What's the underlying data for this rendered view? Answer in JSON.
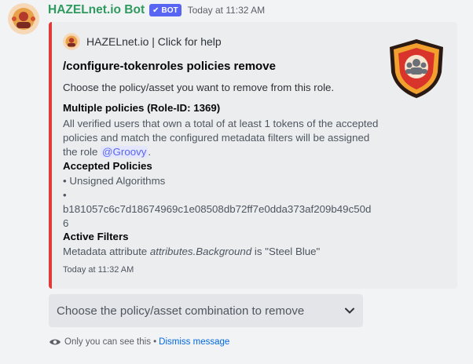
{
  "message": {
    "author": "HAZELnet.io Bot",
    "bot_tag": "BOT",
    "timestamp": "Today at 11:32 AM"
  },
  "embed": {
    "accent_color": "#e03a3a",
    "author_name": "HAZELnet.io | Click for help",
    "title": "/configure-tokenroles policies remove",
    "description": "Choose the policy/asset you want to remove from this role.",
    "fields": [
      {
        "name": "Multiple policies (Role-ID: 1369)",
        "value_lines": [
          "All verified users that own a total of at least 1 tokens of the accepted",
          "policies and match the configured metadata filters will be assigned"
        ],
        "value_tail": "the role ",
        "mention": "@Groovy",
        "value_end": "."
      },
      {
        "name": "Accepted Policies",
        "value_lines": [
          "• Unsigned Algorithms",
          "•",
          "b181057c6c7d18674969c1e08508db72ff7e0dda373af209b49c50d",
          "6"
        ]
      },
      {
        "name": "Active Filters",
        "value_prefix": "Metadata attribute ",
        "value_italic": "attributes.Background",
        "value_suffix": " is \"Steel Blue\""
      }
    ],
    "footer_timestamp": "Today at 11:32 AM"
  },
  "select_menu": {
    "placeholder": "Choose the policy/asset combination to remove",
    "icon": "chevron-down-icon"
  },
  "ephemeral": {
    "text": "Only you can see this •",
    "dismiss_label": "Dismiss message",
    "icon": "eye-icon"
  }
}
